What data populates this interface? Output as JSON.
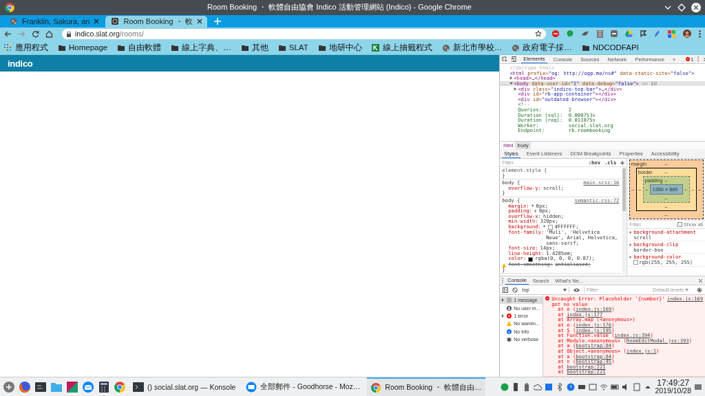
{
  "window": {
    "title": "Room Booking ・ 軟體自由協會 Indico 活動管理網站 (Indico) - Google Chrome"
  },
  "tabs": [
    {
      "label": "Franklin, Sakura, an",
      "selected": false,
      "kind": "globe"
    },
    {
      "label": "Room Booking ・ 軟",
      "selected": true,
      "kind": "site"
    }
  ],
  "address_bar": {
    "host": "indico.slat.org",
    "path": "/rooms/"
  },
  "bookmarks": [
    {
      "label": "應用程式",
      "kind": "apps"
    },
    {
      "label": "Homepage",
      "kind": "folder"
    },
    {
      "label": "自由軟體",
      "kind": "folder"
    },
    {
      "label": "線上字典、…",
      "kind": "folder"
    },
    {
      "label": "其他",
      "kind": "folder"
    },
    {
      "label": "SLAT",
      "kind": "folder"
    },
    {
      "label": "地研中心",
      "kind": "folder"
    },
    {
      "label": "線上抽籤程式",
      "kind": "sheet"
    },
    {
      "label": "新北市學校…",
      "kind": "globe"
    },
    {
      "label": "政府電子採…",
      "kind": "globe"
    },
    {
      "label": "NDCODFAPI",
      "kind": "folder"
    }
  ],
  "page": {
    "logo": "indico"
  },
  "devtools": {
    "panels": [
      {
        "label": "Elements",
        "selected": true
      },
      {
        "label": "Console",
        "selected": false
      },
      {
        "label": "Sources",
        "selected": false
      },
      {
        "label": "Network",
        "selected": false
      },
      {
        "label": "Performance",
        "selected": false
      }
    ],
    "more": "»",
    "error_count": "1",
    "dom": [
      {
        "tokens": [
          {
            "kind": "doctype",
            "text": "<!doctype html>"
          }
        ],
        "selected": false
      },
      {
        "tokens": [
          {
            "kind": "tag",
            "text": "<html"
          },
          {
            "kind": "attr",
            "text": " prefix="
          },
          {
            "kind": "value",
            "text": "\"og: http://ogp.me/ns#\""
          },
          {
            "kind": "attr",
            "text": " data-static-site="
          },
          {
            "kind": "value",
            "text": "\"false\""
          },
          {
            "kind": "tag",
            "text": ">"
          }
        ],
        "selected": false,
        "children": [
          {
            "tokens": [
              {
                "kind": "tag",
                "text": "<head>"
              },
              {
                "kind": "text",
                "text": "…"
              },
              {
                "kind": "tag",
                "text": "</head>"
              }
            ],
            "expanded": false,
            "selected": false
          },
          {
            "gutter": "...",
            "tokens": [
              {
                "kind": "tag",
                "text": "<body"
              },
              {
                "kind": "attr",
                "text": " data-user-id="
              },
              {
                "kind": "value",
                "text": "\"1\""
              },
              {
                "kind": "attr",
                "text": " data-debug="
              },
              {
                "kind": "value",
                "text": "\"false\""
              },
              {
                "kind": "tag",
                "text": ">"
              },
              {
                "kind": "dim",
                "text": " == $0"
              }
            ],
            "expanded": true,
            "selected": true,
            "children": [
              {
                "tokens": [
                  {
                    "kind": "tag",
                    "text": "<div"
                  },
                  {
                    "kind": "attr",
                    "text": " class="
                  },
                  {
                    "kind": "value",
                    "text": "\"indico-top-bar\""
                  },
                  {
                    "kind": "tag",
                    "text": ">"
                  },
                  {
                    "kind": "text",
                    "text": "…"
                  },
                  {
                    "kind": "tag",
                    "text": "</div>"
                  }
                ],
                "expanded": false,
                "selected": false
              },
              {
                "tokens": [
                  {
                    "kind": "tag",
                    "text": "<div"
                  },
                  {
                    "kind": "attr",
                    "text": " id="
                  },
                  {
                    "kind": "value",
                    "text": "\"rb-app-container\""
                  },
                  {
                    "kind": "tag",
                    "text": "></div>"
                  }
                ],
                "selected": false
              },
              {
                "tokens": [
                  {
                    "kind": "tag",
                    "text": "<div"
                  },
                  {
                    "kind": "attr",
                    "text": " id="
                  },
                  {
                    "kind": "value",
                    "text": "\"outdated-browser\""
                  },
                  {
                    "kind": "tag",
                    "text": "></div>"
                  }
                ],
                "selected": false
              },
              {
                "tokens": [
                  {
                    "kind": "comment",
                    "text": "<!--"
                  }
                ],
                "selected": false,
                "lines": [
                  "Queries:         2",
                  "Duration (sql):  0.000753s",
                  "Duration (req):  0.011075s",
                  "Worker:          social.slat.org",
                  "Endpoint:        rb.roombooking"
                ]
              }
            ]
          }
        ]
      }
    ],
    "breadcrumbs": [
      {
        "label": "html",
        "selected": false
      },
      {
        "label": "body",
        "selected": true
      }
    ],
    "sidebar_tabs": [
      {
        "label": "Styles",
        "selected": true
      },
      {
        "label": "Event Listeners",
        "selected": false
      },
      {
        "label": "DOM Breakpoints",
        "selected": false
      },
      {
        "label": "Properties",
        "selected": false
      },
      {
        "label": "Accessibility",
        "selected": false
      }
    ],
    "styles_filter": {
      "placeholder": "Filter"
    },
    "style_tools": [
      ":hov",
      ".cls"
    ],
    "rules": [
      {
        "selector": "element.style {",
        "close": "}"
      },
      {
        "selector": "body {",
        "source": "main.scss:16",
        "close": "}",
        "declarations": [
          {
            "name": "overflow-y:",
            "value": "scroll;",
            "expandable": false,
            "invalid": false
          }
        ]
      },
      {
        "selector": "body {",
        "source": "semantic.css:72",
        "close": "}",
        "declarations": [
          {
            "name": "margin:",
            "value": "0px;",
            "expandable": true,
            "invalid": false
          },
          {
            "name": "padding:",
            "value": "0px;",
            "expandable": true,
            "invalid": false
          },
          {
            "name": "overflow-x:",
            "value": "hidden;",
            "expandable": false,
            "invalid": false
          },
          {
            "name": "min-width:",
            "value": "320px;",
            "expandable": false,
            "invalid": false
          },
          {
            "name": "background:",
            "value": "#FFFFFF;",
            "expandable": true,
            "invalid": false,
            "color": "#ffffff"
          },
          {
            "name": "font-family:",
            "value": "'Muli', 'Helvetica Neue', Arial, Helvetica, sans-serif;",
            "expandable": false,
            "invalid": false
          },
          {
            "name": "font-size:",
            "value": "14px;",
            "expandable": false,
            "invalid": false
          },
          {
            "name": "line-height:",
            "value": "1.4285em;",
            "expandable": false,
            "invalid": false
          },
          {
            "name": "color:",
            "value": "rgba(0, 0, 0, 0.87);",
            "expandable": false,
            "invalid": false,
            "color": "#000000"
          },
          {
            "name": "font-smoothing:",
            "value": "antialiased;",
            "expandable": false,
            "invalid": true
          }
        ]
      }
    ],
    "box_model": {
      "kind": "margin",
      "label": "margin",
      "top": "–",
      "left": "–",
      "right": "–",
      "bottom": "–",
      "inner": {
        "kind": "border",
        "label": "border",
        "top": "–",
        "left": "–",
        "right": "–",
        "bottom": "–",
        "inner": {
          "kind": "padding",
          "label": "padding",
          "top": "–",
          "left": "–",
          "right": "–",
          "bottom": "–",
          "content": "1350 × 889"
        }
      }
    },
    "computed_filter": {
      "placeholder": "Filter"
    },
    "show_all": {
      "label": "Show all",
      "checked": false
    },
    "computed": [
      {
        "property": "background-attachment",
        "value": "scroll",
        "expanded": false
      },
      {
        "property": "background-clip",
        "value": "border-box",
        "expanded": false
      },
      {
        "property": "background-color",
        "value": "rgb(255, 255, 255)",
        "expanded": false,
        "color": "#ffffff"
      }
    ],
    "drawer": {
      "tabs": [
        {
          "label": "Console",
          "selected": true
        },
        {
          "label": "Search",
          "selected": false
        },
        {
          "label": "What's Ne...",
          "selected": false
        }
      ],
      "context": "top",
      "filter": {
        "placeholder": "Filter"
      },
      "levels": "Default levels",
      "sidebar": [
        {
          "label": "1 message",
          "kind": "messages",
          "selected": true,
          "expanded": false
        },
        {
          "label": "No user m...",
          "kind": "user",
          "selected": false
        },
        {
          "label": "1 error",
          "kind": "error",
          "selected": false,
          "expanded": false
        },
        {
          "label": "No warnin...",
          "kind": "warning",
          "selected": false
        },
        {
          "label": "No info",
          "kind": "info",
          "selected": false
        },
        {
          "label": "No verbose",
          "kind": "verbose",
          "selected": false
        }
      ],
      "error": {
        "message": "Uncaught Error: Placeholder '{number}' got no value",
        "source": "index.js:169",
        "stack": [
          {
            "text": "at e (",
            "link": "index.js:169",
            "end": ")"
          },
          {
            "text": "at ",
            "link": "index.js:177"
          },
          {
            "text": "at Array.map (<anonymous>)"
          },
          {
            "text": "at e (",
            "link": "index.js:176",
            "end": ")"
          },
          {
            "text": "at S (",
            "link": "index.js:195",
            "end": ")"
          },
          {
            "text": "at Function.value (",
            "link": "index.js:394",
            "end": ")"
          },
          {
            "text": "at Module.<anonymous> (",
            "link": "RoomEditModal.jsx:393",
            "end": ")"
          },
          {
            "text": "at a (",
            "link": "bootstrap:84",
            "end": ")"
          },
          {
            "text": "at Object.<anonymous> (",
            "link": "index.js:1",
            "end": ")"
          },
          {
            "text": "at a (",
            "link": "bootstrap:84",
            "end": ")"
          },
          {
            "text": "at n (",
            "link": "bootstrap:45",
            "end": ")"
          },
          {
            "text": "at ",
            "link": "bootstrap:221"
          },
          {
            "text": "at ",
            "link": "bootstrap:221"
          }
        ]
      }
    }
  },
  "taskbar": {
    "tasks": [
      {
        "label": "() social.slat.org — Konsole",
        "kind": "terminal",
        "selected": false
      },
      {
        "label": "全部郵件 - Goodhorse - Moz…",
        "kind": "mail",
        "selected": false
      },
      {
        "label": "Room Booking ・ 軟體自由…",
        "kind": "browser",
        "selected": true
      }
    ],
    "time": "17:49:27",
    "date": "2019/10/28"
  }
}
